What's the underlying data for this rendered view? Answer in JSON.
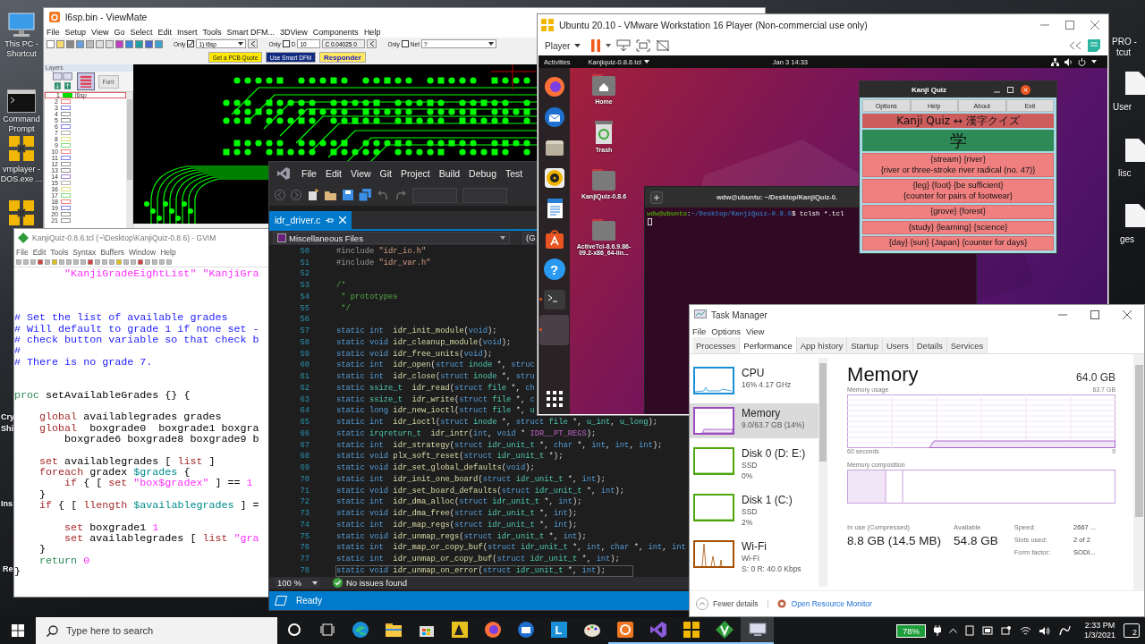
{
  "desktop": {
    "left_icons": [
      {
        "kind": "pc",
        "label": "This PC - Shortcut"
      },
      {
        "kind": "cmd",
        "label": "Command Prompt"
      },
      {
        "kind": "vmware",
        "label": "vmplayer - DOS.exe ..."
      },
      {
        "kind": "vmware"
      }
    ],
    "cut_labels_left": [
      "Cry",
      "Shi",
      "Ins",
      "Re"
    ],
    "cut_labels_right": [
      "PRO -",
      "tcut",
      "User",
      "lisc",
      "ges"
    ]
  },
  "viewmate": {
    "title": "l6sp.bin - ViewMate",
    "menu": [
      "File",
      "Setup",
      "View",
      "Go",
      "Select",
      "Edit",
      "Insert",
      "Tools",
      "Smart DFM...",
      "3DView",
      "Components",
      "Help"
    ],
    "toolbar": {
      "only_layer": {
        "label": "Only",
        "checked": true,
        "value": "1) l6sp"
      },
      "only_d": {
        "label": "Only",
        "checked": false,
        "d_label": "D",
        "d_value": "10",
        "coord": "C 0.04025 0"
      },
      "only_net": {
        "label": "Only",
        "checked": false,
        "net_label": "Net",
        "net_value": "?"
      }
    },
    "buttons": [
      {
        "label": "Get a PCB Quote",
        "kind": "quote"
      },
      {
        "label": "Use Smart DFM",
        "kind": "dfm"
      },
      {
        "label": "Responder",
        "kind": "responder"
      }
    ],
    "layers_panel": {
      "title": "Layers",
      "font_button": "Font",
      "layers": [
        {
          "number": "1",
          "name": "l6sp",
          "color": "#00e000",
          "selected": true
        },
        {
          "number": "2",
          "color": "#f08080",
          "selected": false
        },
        {
          "number": "3",
          "color": "#8080f0",
          "selected": false
        },
        {
          "number": "4",
          "color": "#909090",
          "selected": false
        },
        {
          "number": "5",
          "color": "#909090",
          "selected": false
        },
        {
          "number": "6",
          "color": "#8080f0",
          "selected": false
        },
        {
          "number": "7",
          "color": "#b0b0b0",
          "selected": false
        },
        {
          "number": "8",
          "color": "#e0e080",
          "selected": false
        },
        {
          "number": "9",
          "color": "#80e080",
          "selected": false
        },
        {
          "number": "10",
          "color": "#f08080",
          "selected": false
        },
        {
          "number": "11",
          "color": "#8080f0",
          "selected": false
        },
        {
          "number": "12",
          "color": "#909090",
          "selected": false
        },
        {
          "number": "13",
          "color": "#909090",
          "selected": false
        },
        {
          "number": "14",
          "color": "#a080d0",
          "selected": false
        },
        {
          "number": "15",
          "color": "#b0b0b0",
          "selected": false
        },
        {
          "number": "16",
          "color": "#e0e080",
          "selected": false
        },
        {
          "number": "17",
          "color": "#80e080",
          "selected": false
        },
        {
          "number": "18",
          "color": "#f08080",
          "selected": false
        },
        {
          "number": "19",
          "color": "#8080f0",
          "selected": false
        },
        {
          "number": "20",
          "color": "#909090",
          "selected": false
        },
        {
          "number": "21",
          "color": "#909090",
          "selected": false
        }
      ]
    }
  },
  "gvim": {
    "title": "KanjiQuiz-0.8.6.tcl (~\\Desktop\\KanjiQuiz-0.8.6) - GVIM",
    "menu": [
      "File",
      "Edit",
      "Tools",
      "Syntax",
      "Buffers",
      "Window",
      "Help"
    ],
    "lines": [
      {
        "kind": "code",
        "segments": [
          {
            "text": "        \"KanjiGradeEightList\" \"KanjiGra",
            "kind": "string"
          }
        ]
      },
      {
        "kind": "blank"
      },
      {
        "kind": "blank"
      },
      {
        "kind": "blank"
      },
      {
        "kind": "code",
        "segments": [
          {
            "text": "# Set the list of available grades",
            "kind": "comment"
          }
        ]
      },
      {
        "kind": "code",
        "segments": [
          {
            "text": "# Will default to grade 1 if none set -",
            "kind": "comment"
          }
        ]
      },
      {
        "kind": "code",
        "segments": [
          {
            "text": "# check button variable so that check b",
            "kind": "comment"
          }
        ]
      },
      {
        "kind": "code",
        "segments": [
          {
            "text": "#",
            "kind": "comment"
          }
        ]
      },
      {
        "kind": "code",
        "segments": [
          {
            "text": "# There is no grade 7.",
            "kind": "comment"
          }
        ]
      },
      {
        "kind": "blank"
      },
      {
        "kind": "blank"
      },
      {
        "kind": "code",
        "segments": [
          {
            "text": "proc",
            "kind": "proc"
          },
          {
            "text": " setAvailableGrades {} {",
            "kind": "plain"
          }
        ]
      },
      {
        "kind": "blank"
      },
      {
        "kind": "code",
        "segments": [
          {
            "text": "    global",
            "kind": "keyword"
          },
          {
            "text": " availablegrades grades",
            "kind": "plain"
          }
        ]
      },
      {
        "kind": "code",
        "segments": [
          {
            "text": "    global",
            "kind": "keyword"
          },
          {
            "text": "  boxgrade0  boxgrade1 boxgra",
            "kind": "plain"
          }
        ]
      },
      {
        "kind": "code",
        "segments": [
          {
            "text": "        boxgrade6 boxgrade8 boxgrade9 b",
            "kind": "plain"
          }
        ]
      },
      {
        "kind": "blank"
      },
      {
        "kind": "code",
        "segments": [
          {
            "text": "    set",
            "kind": "keyword"
          },
          {
            "text": " availablegrades [ ",
            "kind": "plain"
          },
          {
            "text": "list",
            "kind": "keyword"
          },
          {
            "text": " ]",
            "kind": "plain"
          }
        ]
      },
      {
        "kind": "code",
        "segments": [
          {
            "text": "    foreach",
            "kind": "keyword"
          },
          {
            "text": " gradex ",
            "kind": "plain"
          },
          {
            "text": "$grades",
            "kind": "variable"
          },
          {
            "text": " {",
            "kind": "plain"
          }
        ]
      },
      {
        "kind": "code",
        "segments": [
          {
            "text": "        if",
            "kind": "keyword"
          },
          {
            "text": " { [ ",
            "kind": "plain"
          },
          {
            "text": "set",
            "kind": "keyword"
          },
          {
            "text": " \"box$gradex\"",
            "kind": "string"
          },
          {
            "text": " ] == ",
            "kind": "plain"
          },
          {
            "text": "1",
            "kind": "number"
          }
        ]
      },
      {
        "kind": "code",
        "segments": [
          {
            "text": "    }",
            "kind": "plain"
          }
        ]
      },
      {
        "kind": "code",
        "segments": [
          {
            "text": "    if",
            "kind": "keyword"
          },
          {
            "text": " { [ ",
            "kind": "plain"
          },
          {
            "text": "llength",
            "kind": "keyword"
          },
          {
            "text": " $availablegrades",
            "kind": "variable"
          },
          {
            "text": " ] =",
            "kind": "plain"
          }
        ]
      },
      {
        "kind": "blank"
      },
      {
        "kind": "code",
        "segments": [
          {
            "text": "        set",
            "kind": "keyword"
          },
          {
            "text": " boxgrade1 ",
            "kind": "plain"
          },
          {
            "text": "1",
            "kind": "number"
          }
        ]
      },
      {
        "kind": "code",
        "segments": [
          {
            "text": "        set",
            "kind": "keyword"
          },
          {
            "text": " availablegrades [ ",
            "kind": "plain"
          },
          {
            "text": "list",
            "kind": "keyword"
          },
          {
            "text": " \"gra",
            "kind": "string"
          }
        ]
      },
      {
        "kind": "code",
        "segments": [
          {
            "text": "    }",
            "kind": "plain"
          }
        ]
      },
      {
        "kind": "code",
        "segments": [
          {
            "text": "    return",
            "kind": "proc"
          },
          {
            "text": " 0",
            "kind": "number"
          }
        ]
      },
      {
        "kind": "code",
        "segments": [
          {
            "text": "}",
            "kind": "plain"
          }
        ]
      }
    ]
  },
  "vs": {
    "menu": [
      "File",
      "Edit",
      "View",
      "Git",
      "Project",
      "Build",
      "Debug",
      "Test"
    ],
    "tab": {
      "label": "idr_driver.c",
      "selected": true
    },
    "nav": "Miscellaneous Files",
    "nav_scope": "(G",
    "lines": [
      {
        "number": "50",
        "current": false,
        "segments": [
          {
            "text": "#include ",
            "kind": "preprocessor"
          },
          {
            "text": "\"idr_io.h\"",
            "kind": "string"
          }
        ]
      },
      {
        "number": "51",
        "current": false,
        "segments": [
          {
            "text": "#include ",
            "kind": "preprocessor"
          },
          {
            "text": "\"idr_var.h\"",
            "kind": "string"
          }
        ]
      },
      {
        "number": "52",
        "current": false
      },
      {
        "number": "53",
        "current": false,
        "segments": [
          {
            "text": "/*",
            "kind": "comment"
          }
        ]
      },
      {
        "number": "54",
        "current": false,
        "segments": [
          {
            "text": " * prototypes",
            "kind": "comment"
          }
        ]
      },
      {
        "number": "55",
        "current": false,
        "segments": [
          {
            "text": " */",
            "kind": "comment"
          }
        ]
      },
      {
        "number": "56",
        "current": false
      },
      {
        "number": "57",
        "current": false,
        "segments": [
          {
            "text": "static int  ",
            "kind": "keyword"
          },
          {
            "text": "idr_init_module",
            "kind": "function"
          },
          {
            "text": "(",
            "kind": "plain"
          },
          {
            "text": "void",
            "kind": "keyword"
          },
          {
            "text": ");",
            "kind": "plain"
          }
        ]
      },
      {
        "number": "58",
        "current": false,
        "segments": [
          {
            "text": "static void ",
            "kind": "keyword"
          },
          {
            "text": "idr_cleanup_module",
            "kind": "function"
          },
          {
            "text": "(",
            "kind": "plain"
          },
          {
            "text": "void",
            "kind": "keyword"
          },
          {
            "text": ");",
            "kind": "plain"
          }
        ]
      },
      {
        "number": "59",
        "current": false,
        "segments": [
          {
            "text": "static void ",
            "kind": "keyword"
          },
          {
            "text": "idr_free_units",
            "kind": "function"
          },
          {
            "text": "(",
            "kind": "plain"
          },
          {
            "text": "void",
            "kind": "keyword"
          },
          {
            "text": ");",
            "kind": "plain"
          }
        ]
      },
      {
        "number": "60",
        "current": false,
        "segments": [
          {
            "text": "static int  ",
            "kind": "keyword"
          },
          {
            "text": "idr_open",
            "kind": "function"
          },
          {
            "text": "(",
            "kind": "plain"
          },
          {
            "text": "struct ",
            "kind": "keyword"
          },
          {
            "text": "inode",
            "kind": "type"
          },
          {
            "text": " *, ",
            "kind": "plain"
          },
          {
            "text": "struc",
            "kind": "keyword"
          }
        ]
      },
      {
        "number": "61",
        "current": false,
        "segments": [
          {
            "text": "static int  ",
            "kind": "keyword"
          },
          {
            "text": "idr_close",
            "kind": "function"
          },
          {
            "text": "(",
            "kind": "plain"
          },
          {
            "text": "struct ",
            "kind": "keyword"
          },
          {
            "text": "inode",
            "kind": "type"
          },
          {
            "text": " *, ",
            "kind": "plain"
          },
          {
            "text": "stru",
            "kind": "keyword"
          }
        ]
      },
      {
        "number": "62",
        "current": false,
        "segments": [
          {
            "text": "static ",
            "kind": "keyword"
          },
          {
            "text": "ssize_t",
            "kind": "type"
          },
          {
            "text": "  idr_read",
            "kind": "function"
          },
          {
            "text": "(",
            "kind": "plain"
          },
          {
            "text": "struct ",
            "kind": "keyword"
          },
          {
            "text": "file",
            "kind": "type"
          },
          {
            "text": " *, ",
            "kind": "plain"
          },
          {
            "text": "ch",
            "kind": "keyword"
          }
        ]
      },
      {
        "number": "63",
        "current": false,
        "segments": [
          {
            "text": "static ",
            "kind": "keyword"
          },
          {
            "text": "ssize_t",
            "kind": "type"
          },
          {
            "text": "  idr_write",
            "kind": "function"
          },
          {
            "text": "(",
            "kind": "plain"
          },
          {
            "text": "struct ",
            "kind": "keyword"
          },
          {
            "text": "file",
            "kind": "type"
          },
          {
            "text": " *, ",
            "kind": "plain"
          },
          {
            "text": "c",
            "kind": "keyword"
          }
        ]
      },
      {
        "number": "64",
        "current": false,
        "segments": [
          {
            "text": "static long ",
            "kind": "keyword"
          },
          {
            "text": "idr_new_ioctl",
            "kind": "function"
          },
          {
            "text": "(",
            "kind": "plain"
          },
          {
            "text": "struct ",
            "kind": "keyword"
          },
          {
            "text": "file",
            "kind": "type"
          },
          {
            "text": " *, ",
            "kind": "plain"
          },
          {
            "text": "u",
            "kind": "type"
          }
        ]
      },
      {
        "number": "65",
        "current": false,
        "segments": [
          {
            "text": "static int  ",
            "kind": "keyword"
          },
          {
            "text": "idr_ioctl",
            "kind": "function"
          },
          {
            "text": "(",
            "kind": "plain"
          },
          {
            "text": "struct ",
            "kind": "keyword"
          },
          {
            "text": "inode",
            "kind": "type"
          },
          {
            "text": " *, ",
            "kind": "plain"
          },
          {
            "text": "struct ",
            "kind": "keyword"
          },
          {
            "text": "file",
            "kind": "type"
          },
          {
            "text": " *, ",
            "kind": "plain"
          },
          {
            "text": "u_int",
            "kind": "type"
          },
          {
            "text": ", ",
            "kind": "plain"
          },
          {
            "text": "u_long",
            "kind": "type"
          },
          {
            "text": ");",
            "kind": "plain"
          }
        ]
      },
      {
        "number": "66",
        "current": false,
        "segments": [
          {
            "text": "static ",
            "kind": "keyword"
          },
          {
            "text": "irqreturn_t",
            "kind": "type"
          },
          {
            "text": "  idr_intr",
            "kind": "function"
          },
          {
            "text": "(",
            "kind": "plain"
          },
          {
            "text": "int",
            "kind": "keyword"
          },
          {
            "text": ", ",
            "kind": "plain"
          },
          {
            "text": "void",
            "kind": "keyword"
          },
          {
            "text": " * ",
            "kind": "plain"
          },
          {
            "text": "IDR__PT_REGS",
            "kind": "macro"
          },
          {
            "text": ");",
            "kind": "plain"
          }
        ]
      },
      {
        "number": "67",
        "current": false,
        "segments": [
          {
            "text": "static int  ",
            "kind": "keyword"
          },
          {
            "text": "idr_strategy",
            "kind": "function"
          },
          {
            "text": "(",
            "kind": "plain"
          },
          {
            "text": "struct ",
            "kind": "keyword"
          },
          {
            "text": "idr_unit_t",
            "kind": "type"
          },
          {
            "text": " *, ",
            "kind": "plain"
          },
          {
            "text": "char",
            "kind": "keyword"
          },
          {
            "text": " *, ",
            "kind": "plain"
          },
          {
            "text": "int",
            "kind": "keyword"
          },
          {
            "text": ", ",
            "kind": "plain"
          },
          {
            "text": "int",
            "kind": "keyword"
          },
          {
            "text": ", ",
            "kind": "plain"
          },
          {
            "text": "int",
            "kind": "keyword"
          },
          {
            "text": ");",
            "kind": "plain"
          }
        ]
      },
      {
        "number": "68",
        "current": false,
        "segments": [
          {
            "text": "static void ",
            "kind": "keyword"
          },
          {
            "text": "plx_soft_reset",
            "kind": "function"
          },
          {
            "text": "(",
            "kind": "plain"
          },
          {
            "text": "struct ",
            "kind": "keyword"
          },
          {
            "text": "idr_unit_t",
            "kind": "type"
          },
          {
            "text": " *);",
            "kind": "plain"
          }
        ]
      },
      {
        "number": "69",
        "current": false,
        "segments": [
          {
            "text": "static void ",
            "kind": "keyword"
          },
          {
            "text": "idr_set_global_defaults",
            "kind": "function"
          },
          {
            "text": "(",
            "kind": "plain"
          },
          {
            "text": "void",
            "kind": "keyword"
          },
          {
            "text": ");",
            "kind": "plain"
          }
        ]
      },
      {
        "number": "70",
        "current": false,
        "segments": [
          {
            "text": "static int  ",
            "kind": "keyword"
          },
          {
            "text": "idr_init_one_board",
            "kind": "function"
          },
          {
            "text": "(",
            "kind": "plain"
          },
          {
            "text": "struct ",
            "kind": "keyword"
          },
          {
            "text": "idr_unit_t",
            "kind": "type"
          },
          {
            "text": " *, ",
            "kind": "plain"
          },
          {
            "text": "int",
            "kind": "keyword"
          },
          {
            "text": ");",
            "kind": "plain"
          }
        ]
      },
      {
        "number": "71",
        "current": false,
        "segments": [
          {
            "text": "static void ",
            "kind": "keyword"
          },
          {
            "text": "idr_set_board_defaults",
            "kind": "function"
          },
          {
            "text": "(",
            "kind": "plain"
          },
          {
            "text": "struct ",
            "kind": "keyword"
          },
          {
            "text": "idr_unit_t",
            "kind": "type"
          },
          {
            "text": " *, ",
            "kind": "plain"
          },
          {
            "text": "int",
            "kind": "keyword"
          },
          {
            "text": ");",
            "kind": "plain"
          }
        ]
      },
      {
        "number": "72",
        "current": false,
        "segments": [
          {
            "text": "static int  ",
            "kind": "keyword"
          },
          {
            "text": "idr_dma_alloc",
            "kind": "function"
          },
          {
            "text": "(",
            "kind": "plain"
          },
          {
            "text": "struct ",
            "kind": "keyword"
          },
          {
            "text": "idr_unit_t",
            "kind": "type"
          },
          {
            "text": " *, ",
            "kind": "plain"
          },
          {
            "text": "int",
            "kind": "keyword"
          },
          {
            "text": ");",
            "kind": "plain"
          }
        ]
      },
      {
        "number": "73",
        "current": false,
        "segments": [
          {
            "text": "static void ",
            "kind": "keyword"
          },
          {
            "text": "idr_dma_free",
            "kind": "function"
          },
          {
            "text": "(",
            "kind": "plain"
          },
          {
            "text": "struct ",
            "kind": "keyword"
          },
          {
            "text": "idr_unit_t",
            "kind": "type"
          },
          {
            "text": " *, ",
            "kind": "plain"
          },
          {
            "text": "int",
            "kind": "keyword"
          },
          {
            "text": ");",
            "kind": "plain"
          }
        ]
      },
      {
        "number": "74",
        "current": false,
        "segments": [
          {
            "text": "static int  ",
            "kind": "keyword"
          },
          {
            "text": "idr_map_regs",
            "kind": "function"
          },
          {
            "text": "(",
            "kind": "plain"
          },
          {
            "text": "struct ",
            "kind": "keyword"
          },
          {
            "text": "idr_unit_t",
            "kind": "type"
          },
          {
            "text": " *, ",
            "kind": "plain"
          },
          {
            "text": "int",
            "kind": "keyword"
          },
          {
            "text": ");",
            "kind": "plain"
          }
        ]
      },
      {
        "number": "75",
        "current": false,
        "segments": [
          {
            "text": "static void ",
            "kind": "keyword"
          },
          {
            "text": "idr_unmap_regs",
            "kind": "function"
          },
          {
            "text": "(",
            "kind": "plain"
          },
          {
            "text": "struct ",
            "kind": "keyword"
          },
          {
            "text": "idr_unit_t",
            "kind": "type"
          },
          {
            "text": " *, ",
            "kind": "plain"
          },
          {
            "text": "int",
            "kind": "keyword"
          },
          {
            "text": ");",
            "kind": "plain"
          }
        ]
      },
      {
        "number": "76",
        "current": false,
        "segments": [
          {
            "text": "static int  ",
            "kind": "keyword"
          },
          {
            "text": "idr_map_or_copy_buf",
            "kind": "function"
          },
          {
            "text": "(",
            "kind": "plain"
          },
          {
            "text": "struct ",
            "kind": "keyword"
          },
          {
            "text": "idr_unit_t",
            "kind": "type"
          },
          {
            "text": " *, ",
            "kind": "plain"
          },
          {
            "text": "int",
            "kind": "keyword"
          },
          {
            "text": ", ",
            "kind": "plain"
          },
          {
            "text": "char",
            "kind": "keyword"
          },
          {
            "text": " *, ",
            "kind": "plain"
          },
          {
            "text": "int",
            "kind": "keyword"
          },
          {
            "text": ", ",
            "kind": "plain"
          },
          {
            "text": "int",
            "kind": "keyword"
          }
        ]
      },
      {
        "number": "77",
        "current": false,
        "segments": [
          {
            "text": "static int  ",
            "kind": "keyword"
          },
          {
            "text": "idr_unmap_or_copy_buf",
            "kind": "function"
          },
          {
            "text": "(",
            "kind": "plain"
          },
          {
            "text": "struct ",
            "kind": "keyword"
          },
          {
            "text": "idr_unit_t",
            "kind": "type"
          },
          {
            "text": " *, ",
            "kind": "plain"
          },
          {
            "text": "int",
            "kind": "keyword"
          },
          {
            "text": ");",
            "kind": "plain"
          }
        ]
      },
      {
        "number": "78",
        "current": true,
        "segments": [
          {
            "text": "static void ",
            "kind": "keyword"
          },
          {
            "text": "idr_unmap_on_error",
            "kind": "function"
          },
          {
            "text": "(",
            "kind": "plain"
          },
          {
            "text": "struct ",
            "kind": "keyword"
          },
          {
            "text": "idr_unit_t",
            "kind": "type"
          },
          {
            "text": " *, ",
            "kind": "plain"
          },
          {
            "text": "int",
            "kind": "keyword"
          },
          {
            "text": ");",
            "kind": "plain"
          }
        ]
      }
    ],
    "zoom": "100 %",
    "issues": "No issues found",
    "status": "Ready"
  },
  "vmware": {
    "title": "Ubuntu 20.10 - VMware Workstation 16 Player (Non-commercial use only)",
    "player_menu": "Player",
    "ubuntu": {
      "activities": "Activities",
      "app_menu": "Kanjiquiz-0.8.6.tcl",
      "clock": "Jan 3  14:33",
      "dock": [
        {
          "kind": "firefox",
          "running": false,
          "selected": false
        },
        {
          "kind": "mail",
          "running": false,
          "selected": false
        },
        {
          "kind": "files",
          "running": false,
          "selected": false
        },
        {
          "kind": "music",
          "running": false,
          "selected": false
        },
        {
          "kind": "writer",
          "running": false,
          "selected": false
        },
        {
          "kind": "software",
          "running": false,
          "selected": false
        },
        {
          "kind": "help",
          "glyph": "?",
          "running": false,
          "selected": false
        },
        {
          "kind": "terminal",
          "running": true,
          "selected": false
        },
        {
          "kind": "blank",
          "running": true,
          "selected": true
        }
      ],
      "desktop_icons": [
        {
          "kind": "home",
          "label": "Home"
        },
        {
          "kind": "trash",
          "label": "Trash"
        },
        {
          "kind": "folder",
          "label": "KanjiQuiz-0.8.6"
        },
        {
          "kind": "folder",
          "label": "ActiveTcl-8.6.9.86-09.2-x86_64-lin..."
        }
      ],
      "terminal": {
        "title": "wdw@ubuntu: ~/Desktop/KanjiQuiz-0.",
        "user_host": "wdw@ubuntu",
        "separator": ":",
        "path": "~/Desktop/KanjiQuiz-0.8.6",
        "command": "$ tclsh *.tcl"
      },
      "kanji_quiz": {
        "title": "Kanji Quiz",
        "menu": [
          "Options",
          "Help",
          "About",
          "Exit"
        ],
        "header": "Kanji Quiz ↔ 漢字クイズ",
        "kanji": "学",
        "answers": [
          {
            "lines": [
              "{stream} {river}",
              "{river or three-stroke river radical (no. 47)}"
            ]
          },
          {
            "lines": [
              "{leg} {foot} {be sufficient}",
              "{counter for pairs of footwear}"
            ]
          },
          {
            "lines": [
              "{grove} {forest}"
            ]
          },
          {
            "lines": [
              "{study} {learning} {science}"
            ]
          },
          {
            "lines": [
              "{day} {sun} {Japan} {counter for days}"
            ]
          }
        ]
      }
    }
  },
  "task_manager": {
    "title": "Task Manager",
    "menu": [
      "File",
      "Options",
      "View"
    ],
    "tabs": [
      {
        "label": "Processes",
        "selected": false
      },
      {
        "label": "Performance",
        "selected": true
      },
      {
        "label": "App history",
        "selected": false
      },
      {
        "label": "Startup",
        "selected": false
      },
      {
        "label": "Users",
        "selected": false
      },
      {
        "label": "Details",
        "selected": false
      },
      {
        "label": "Services",
        "selected": false
      }
    ],
    "resources": [
      {
        "name": "CPU",
        "details": [
          "16%  4.17 GHz"
        ],
        "kind": "cpu",
        "color": "#1a8fd8",
        "selected": false
      },
      {
        "name": "Memory",
        "details": [
          "9.0/63.7 GB (14%)"
        ],
        "kind": "memory",
        "color": "#9b4bc0",
        "selected": true
      },
      {
        "name": "Disk 0 (D: E:)",
        "details": [
          "SSD",
          "0%"
        ],
        "kind": "disk",
        "color": "#4da60c",
        "selected": false
      },
      {
        "name": "Disk 1 (C:)",
        "details": [
          "SSD",
          "2%"
        ],
        "kind": "disk",
        "color": "#4da60c",
        "selected": false
      },
      {
        "name": "Wi-Fi",
        "details": [
          "Wi-Fi",
          "S: 0  R: 40.0 Kbps"
        ],
        "kind": "wifi",
        "color": "#a74f01",
        "selected": false
      }
    ],
    "detail": {
      "title": "Memory",
      "total": "64.0 GB",
      "usage_label": "Memory usage",
      "usage_max": "63.7 GB",
      "time_label": "60 seconds",
      "time_end": "0",
      "composition_label": "Memory composition",
      "stats": [
        {
          "label": "In use (Compressed)",
          "value": "8.8 GB (14.5 MB)"
        },
        {
          "label": "Available",
          "value": "54.8 GB"
        }
      ],
      "specs": [
        {
          "label": "Speed:",
          "value": "2667 ..."
        },
        {
          "label": "Slots used:",
          "value": "2 of 2"
        },
        {
          "label": "Form factor:",
          "value": "SODI..."
        }
      ]
    },
    "fewer_details": "Fewer details",
    "resource_monitor": "Open Resource Monitor"
  },
  "taskbar": {
    "search_placeholder": "Type here to search",
    "apps": [
      {
        "kind": "cortana",
        "running": false,
        "selected": false
      },
      {
        "kind": "taskview",
        "running": false,
        "selected": false
      },
      {
        "kind": "edge",
        "running": false,
        "selected": false
      },
      {
        "kind": "explorer",
        "running": false,
        "selected": false
      },
      {
        "kind": "store",
        "running": false,
        "selected": false
      },
      {
        "kind": "game",
        "running": false,
        "selected": false
      },
      {
        "kind": "firefox",
        "running": false,
        "selected": false
      },
      {
        "kind": "mail",
        "running": false,
        "selected": false
      },
      {
        "kind": "letter",
        "label": "L",
        "running": false,
        "selected": false
      },
      {
        "kind": "paint",
        "running": false,
        "selected": false
      },
      {
        "kind": "ring",
        "running": true,
        "selected": false
      },
      {
        "kind": "studio",
        "running": true,
        "selected": false
      },
      {
        "kind": "vmware",
        "running": true,
        "selected": false
      },
      {
        "kind": "vim",
        "running": true,
        "selected": false
      },
      {
        "kind": "monitor",
        "running": true,
        "selected": true
      }
    ],
    "battery": "78%",
    "time": "2:33 PM",
    "date": "1/3/2021",
    "notifications": "2"
  }
}
